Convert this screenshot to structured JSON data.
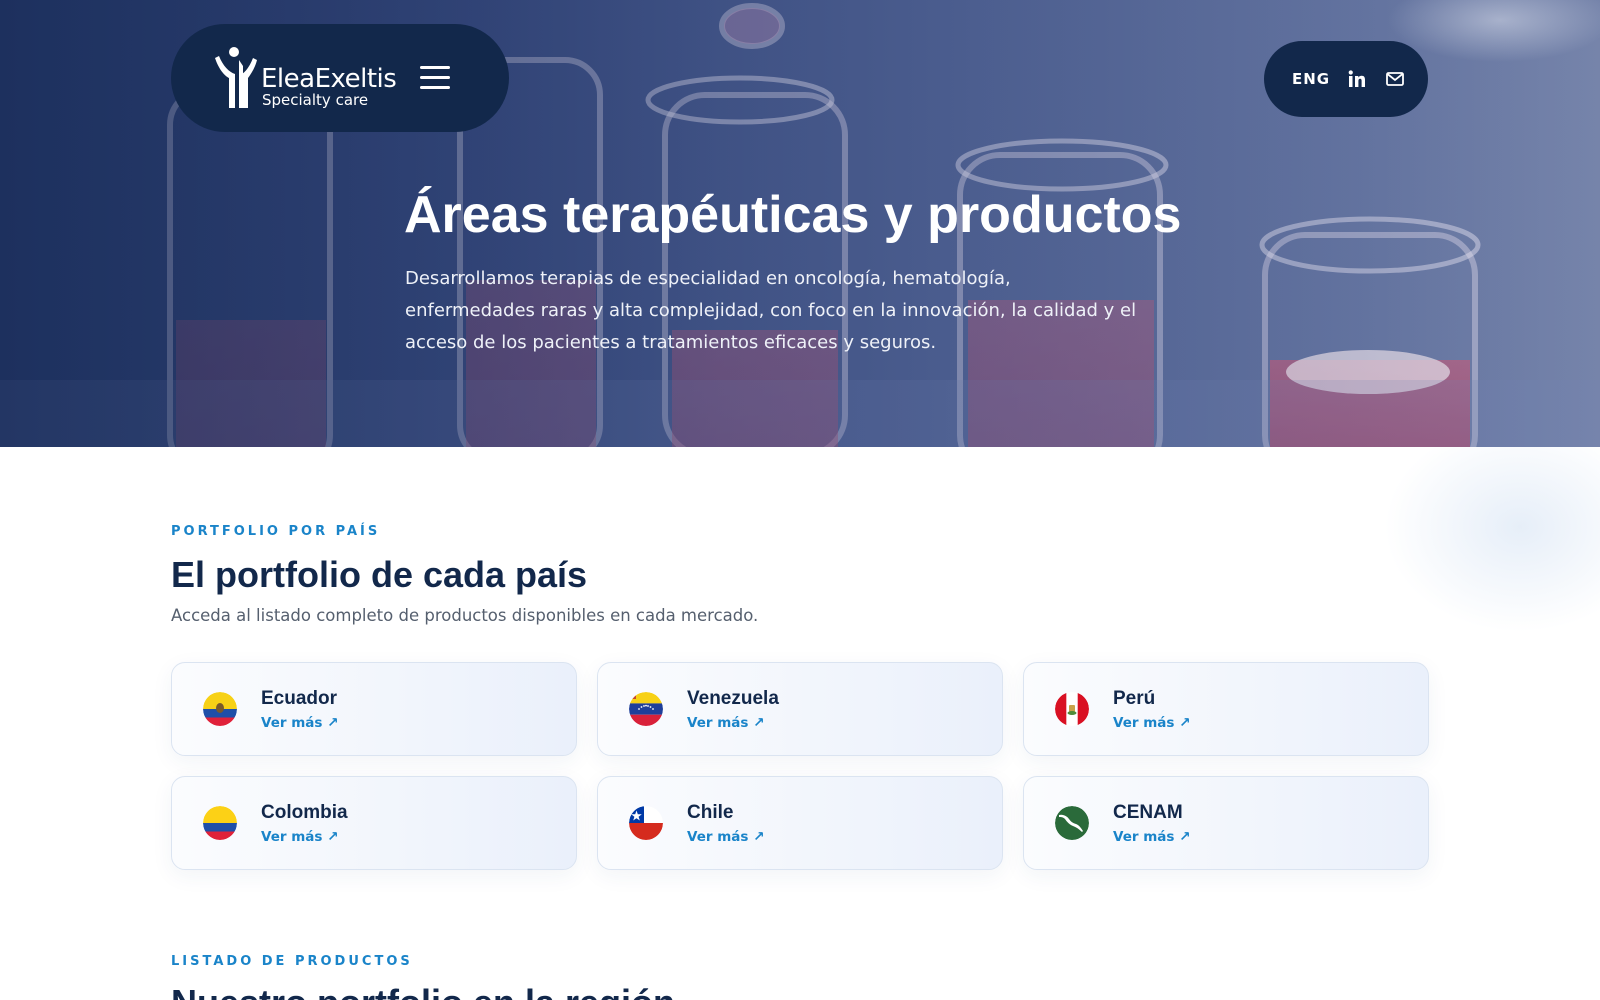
{
  "brand": {
    "name": "EleaExeltis",
    "subtitle": "Specialty care"
  },
  "header": {
    "menu_icon": "hamburger-menu-icon",
    "language": "ENG",
    "linkedin_icon": "linkedin-icon",
    "mail_icon": "mail-icon"
  },
  "hero": {
    "title": "Áreas terapéuticas y productos",
    "description": "Desarrollamos terapias de especialidad en oncología, hematología, enfermedades raras y alta complejidad, con foco en la innovación, la calidad y el acceso de los pacientes a tratamientos eficaces y seguros."
  },
  "portfolio": {
    "eyebrow": "PORTFOLIO POR PAÍS",
    "title": "El portfolio de cada país",
    "subtitle": "Acceda al listado completo de productos disponibles en cada mercado.",
    "link_label": "Ver más ↗",
    "countries": [
      {
        "name": "Ecuador",
        "flag": "ecuador-flag-icon"
      },
      {
        "name": "Venezuela",
        "flag": "venezuela-flag-icon"
      },
      {
        "name": "Perú",
        "flag": "peru-flag-icon"
      },
      {
        "name": "Colombia",
        "flag": "colombia-flag-icon"
      },
      {
        "name": "Chile",
        "flag": "chile-flag-icon"
      },
      {
        "name": "CENAM",
        "flag": "cenam-map-icon"
      }
    ]
  },
  "products": {
    "eyebrow": "LISTADO DE PRODUCTOS",
    "title": "Nuestro portfolio en la región"
  },
  "colors": {
    "navy": "#12284b",
    "accent": "#1a84c9"
  }
}
